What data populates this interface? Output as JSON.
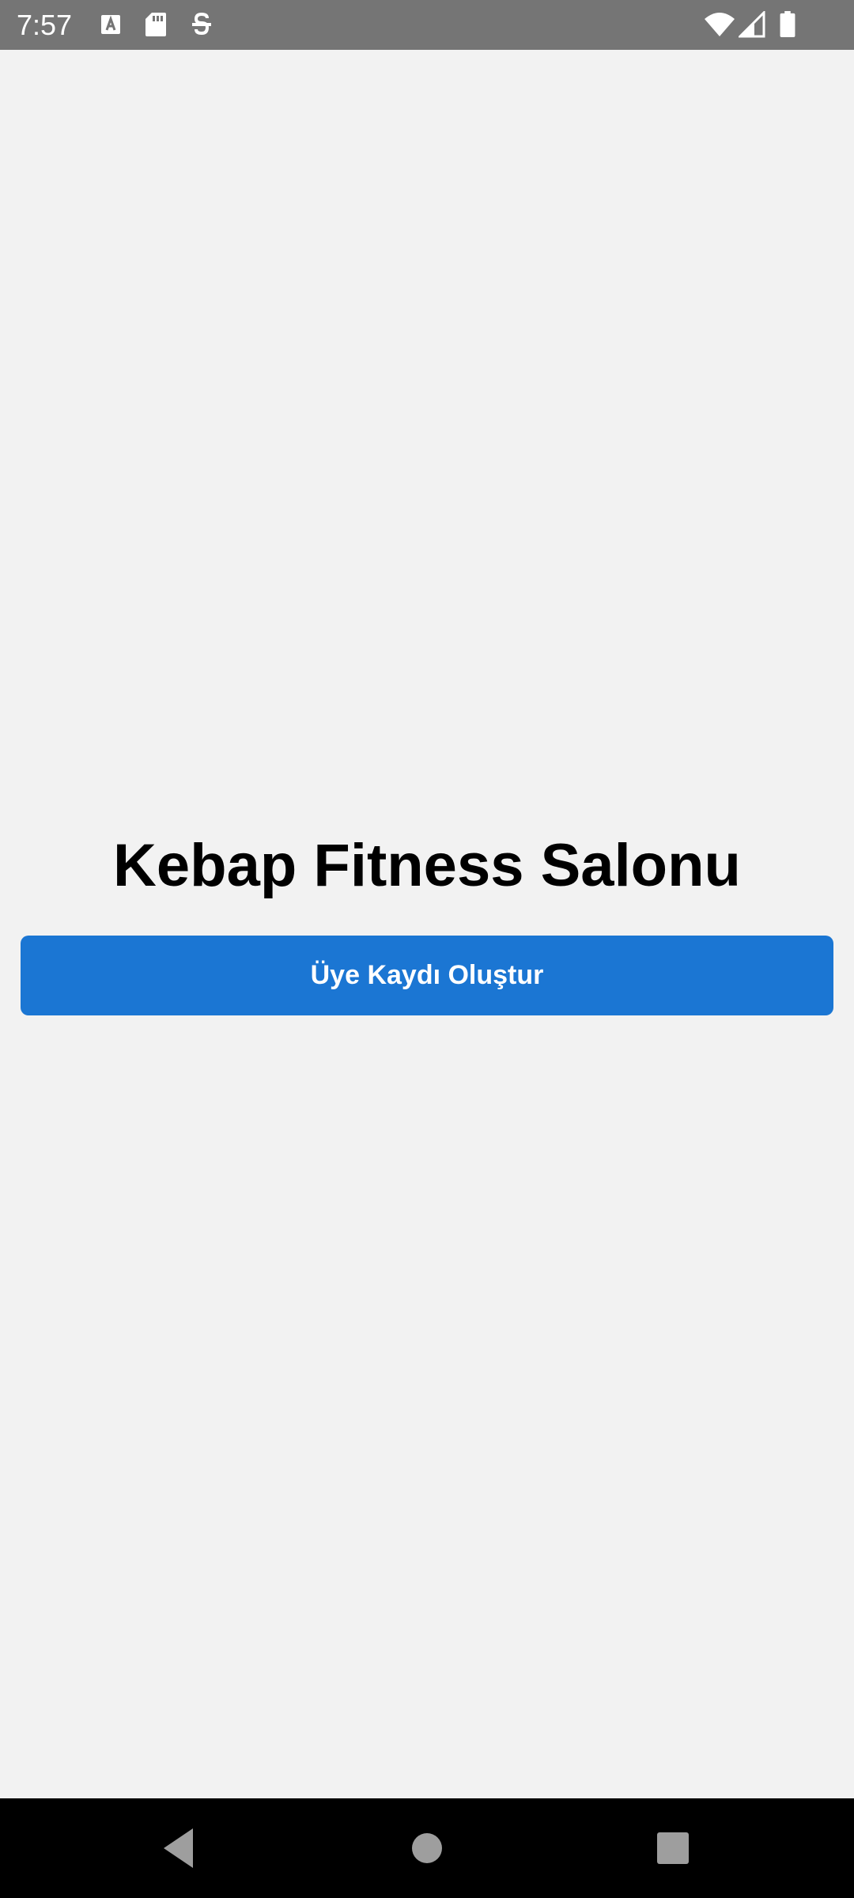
{
  "status_bar": {
    "time": "7:57",
    "left_icons": [
      "font-a-icon",
      "sd-card-icon",
      "app-notification-icon"
    ],
    "right_icons": [
      "wifi-icon",
      "signal-icon",
      "battery-icon"
    ],
    "background": "#757575"
  },
  "main": {
    "title": "Kebap Fitness Salonu",
    "register_button_label": "Üye Kaydı Oluştur",
    "button_color": "#1b76d3",
    "background": "#f2f2f2"
  },
  "nav_bar": {
    "buttons": [
      "back-icon",
      "home-icon",
      "recents-icon"
    ],
    "background": "#000000"
  }
}
